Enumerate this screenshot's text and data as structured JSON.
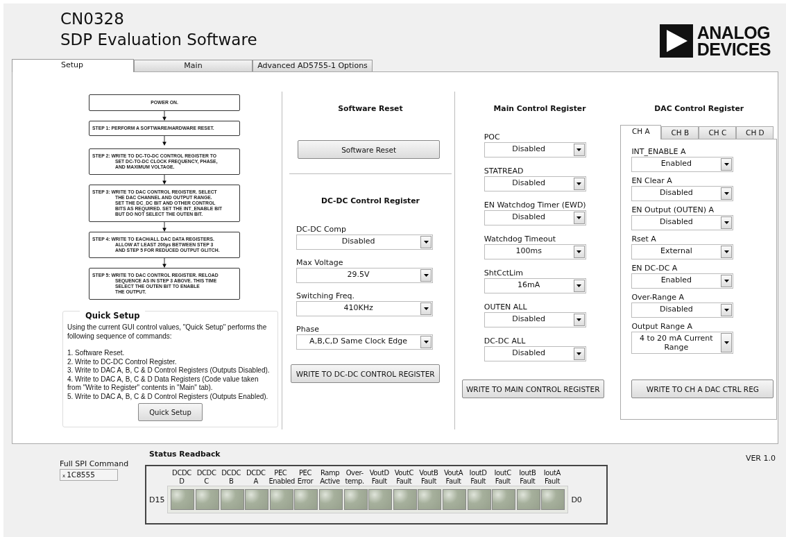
{
  "header": {
    "title_line_1": "CN0328",
    "title_line_2": "SDP Evaluation Software",
    "logo_line_1": "ANALOG",
    "logo_line_2": "DEVICES"
  },
  "tabs": [
    {
      "label": "Setup",
      "selected": true
    },
    {
      "label": "Main",
      "selected": false
    },
    {
      "label": "Advanced AD5755-1 Options",
      "selected": false
    }
  ],
  "flowchart": {
    "steps": [
      "POWER ON.",
      "STEP 1: PERFORM A SOFTWARE/HARDWARE RESET.",
      "STEP 2: WRITE TO DC-TO-DC CONTROL REGISTER TO\nSET DC-TO-DC CLOCK FREQUENCY, PHASE,\nAND MAXIMUM VOLTAGE.",
      "STEP 3: WRITE TO DAC CONTROL REGISTER. SELECT\nTHE DAC CHANNEL AND OUTPUT RANGE.\nSET THE DC_DC BIT AND OTHER CONTROL\nBITS AS REQUIRED. SET THE INT_ENABLE BIT\nBUT DO NOT SELECT THE OUTEN BIT.",
      "STEP 4: WRITE TO EACH/ALL DAC DATA REGISTERS.\nALLOW AT LEAST 200µs BETWEEN STEP 3\nAND STEP 5 FOR REDUCED OUTPUT GLITCH.",
      "STEP 5: WRITE TO DAC CONTROL REGISTER. RELOAD\nSEQUENCE AS IN STEP 3 ABOVE. THIS TIME\nSELECT THE OUTEN BIT TO ENABLE\nTHE OUTPUT."
    ]
  },
  "quick_setup": {
    "title": "Quick Setup",
    "description": "Using the current GUI control values, \"Quick Setup\" performs the following sequence of commands:",
    "steps": [
      "1. Software Reset.",
      "2. Write to DC-DC Control Register.",
      "3. Write to DAC A, B, C & D Control Registers (Outputs Disabled).",
      "4. Write to DAC A, B, C & D Data Registers (Code value taken from \"Write to Register\" contents in \"Main\" tab).",
      "5. Write to DAC A, B, C & D Control Registers (Outputs Enabled)."
    ],
    "button": "Quick Setup"
  },
  "software_reset": {
    "title": "Software Reset",
    "button": "Software Reset"
  },
  "dcdc_control": {
    "title": "DC-DC Control Register",
    "fields": [
      {
        "label": "DC-DC Comp",
        "value": "Disabled"
      },
      {
        "label": "Max Voltage",
        "value": "29.5V"
      },
      {
        "label": "Switching Freq.",
        "value": "410KHz"
      },
      {
        "label": "Phase",
        "value": "A,B,C,D Same Clock Edge"
      }
    ],
    "button": "WRITE TO DC-DC CONTROL REGISTER"
  },
  "main_control": {
    "title": "Main Control Register",
    "fields": [
      {
        "label": "POC",
        "value": "Disabled"
      },
      {
        "label": "STATREAD",
        "value": "Disabled"
      },
      {
        "label": "EN Watchdog Timer (EWD)",
        "value": "Disabled"
      },
      {
        "label": "Watchdog Timeout",
        "value": "100ms"
      },
      {
        "label": "ShtCctLim",
        "value": "16mA"
      },
      {
        "label": "OUTEN ALL",
        "value": "Disabled"
      },
      {
        "label": "DC-DC ALL",
        "value": "Disabled"
      }
    ],
    "button": "WRITE TO MAIN CONTROL REGISTER"
  },
  "dac_control": {
    "title": "DAC Control Register",
    "channel_tabs": [
      {
        "label": "CH A",
        "selected": true
      },
      {
        "label": "CH B",
        "selected": false
      },
      {
        "label": "CH C",
        "selected": false
      },
      {
        "label": "CH D",
        "selected": false
      }
    ],
    "fields": [
      {
        "label": "INT_ENABLE A",
        "value": "Enabled"
      },
      {
        "label": "EN Clear A",
        "value": "Disabled"
      },
      {
        "label": "EN Output (OUTEN) A",
        "value": "Disabled"
      },
      {
        "label": "Rset A",
        "value": "External"
      },
      {
        "label": "EN DC-DC A",
        "value": "Enabled"
      },
      {
        "label": "Over-Range A",
        "value": "Disabled"
      },
      {
        "label": "Output Range A",
        "value": "4 to 20 mA Current Range"
      }
    ],
    "button": "WRITE TO CH A DAC CTRL REG"
  },
  "spi_command": {
    "label": "Full SPI Command",
    "radix": "x",
    "value": "1C8555"
  },
  "status_readback": {
    "title": "Status Readback",
    "start_label": "D15",
    "end_label": "D0",
    "bits": [
      {
        "label": "DCDC\nD",
        "on": false
      },
      {
        "label": "DCDC\nC",
        "on": false
      },
      {
        "label": "DCDC\nB",
        "on": false
      },
      {
        "label": "DCDC\nA",
        "on": false
      },
      {
        "label": "PEC\nEnabled",
        "on": false
      },
      {
        "label": "PEC\nError",
        "on": false
      },
      {
        "label": "Ramp\nActive",
        "on": false
      },
      {
        "label": "Over-\ntemp.",
        "on": false
      },
      {
        "label": "VoutD\nFault",
        "on": false
      },
      {
        "label": "VoutC\nFault",
        "on": false
      },
      {
        "label": "VoutB\nFault",
        "on": false
      },
      {
        "label": "VoutA\nFault",
        "on": false
      },
      {
        "label": "IoutD\nFault",
        "on": false
      },
      {
        "label": "IoutC\nFault",
        "on": false
      },
      {
        "label": "IoutB\nFault",
        "on": false
      },
      {
        "label": "IoutA\nFault",
        "on": false
      }
    ]
  },
  "version": "VER 1.0"
}
